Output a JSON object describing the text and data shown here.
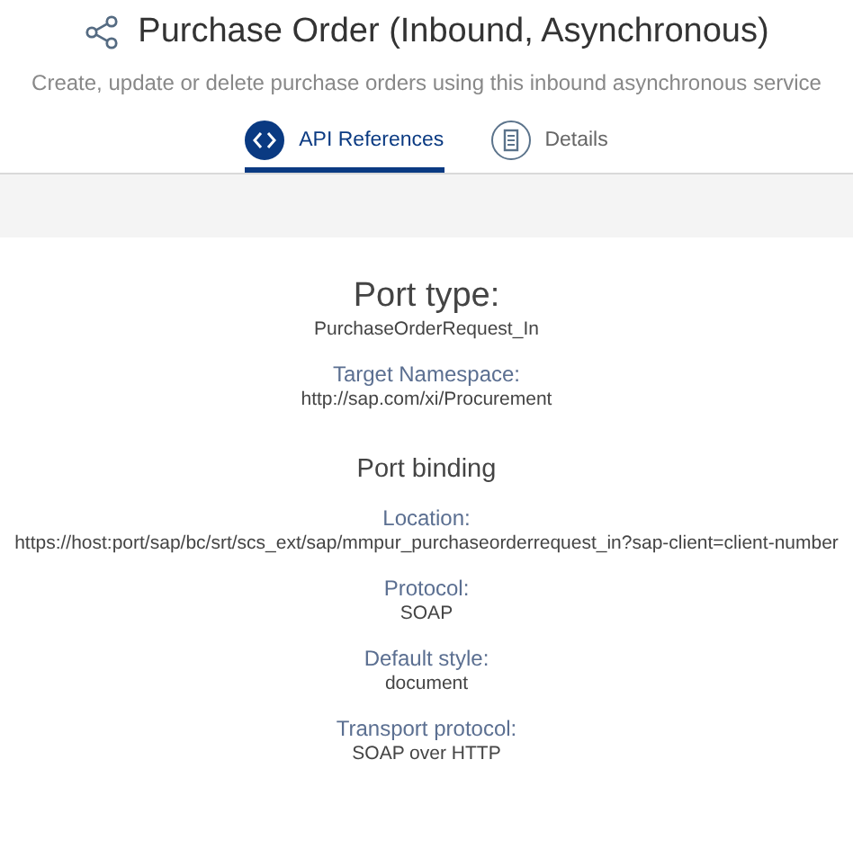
{
  "header": {
    "title": "Purchase Order (Inbound, Asynchronous)",
    "subtitle": "Create, update or delete purchase orders using this inbound asynchronous service"
  },
  "tabs": [
    {
      "label": "API References",
      "kind": "code",
      "selected": true
    },
    {
      "label": "Details",
      "kind": "document",
      "selected": false
    }
  ],
  "port_type": {
    "heading": "Port type:",
    "value": "PurchaseOrderRequest_In",
    "fields": [
      {
        "label": "Target Namespace:",
        "value": "http://sap.com/xi/Procurement"
      }
    ]
  },
  "port_binding": {
    "heading": "Port binding",
    "fields": [
      {
        "label": "Location:",
        "value": "https://host:port/sap/bc/srt/scs_ext/sap/mmpur_purchaseorderrequest_in?sap-client=client-number"
      },
      {
        "label": "Protocol:",
        "value": "SOAP"
      },
      {
        "label": "Default style:",
        "value": "document"
      },
      {
        "label": "Transport protocol:",
        "value": "SOAP over HTTP"
      }
    ]
  }
}
